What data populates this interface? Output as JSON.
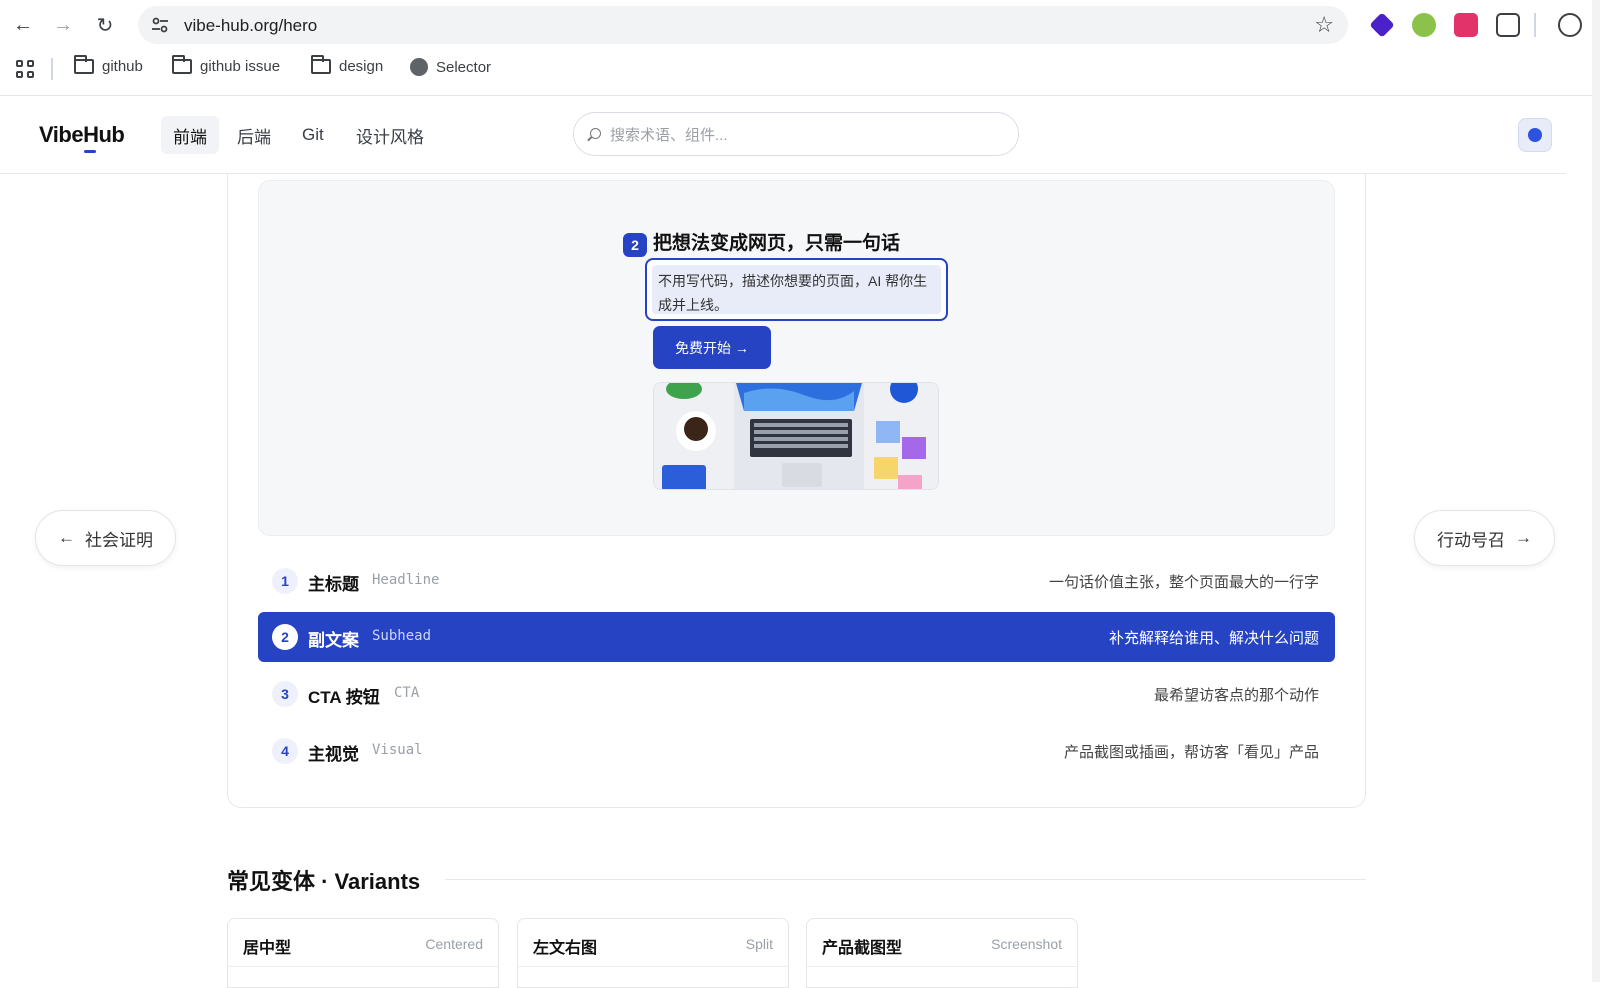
{
  "browser": {
    "url": "vibe-hub.org/hero",
    "bookmarks": [
      {
        "label": "github",
        "icon": "folder-icon"
      },
      {
        "label": "github issue",
        "icon": "folder-icon"
      },
      {
        "label": "design",
        "icon": "folder-icon"
      },
      {
        "label": "Selector",
        "icon": "globe-icon"
      }
    ],
    "extension_colors": [
      "#4b22c9",
      "#5b8a3a",
      "#e2336b",
      "#3c4043"
    ]
  },
  "header": {
    "logo": "VibeHub",
    "nav": [
      "前端",
      "后端",
      "Git",
      "设计风格"
    ],
    "active_nav": "前端",
    "search_placeholder": "搜索术语、组件...",
    "accent_color": "#2643c4"
  },
  "preview": {
    "headline": "把想法变成网页，只需一句话",
    "headline_badge": "2",
    "subhead": "不用写代码，描述你想要的页面，AI 帮你生成并上线。",
    "cta_label": "免费开始 →"
  },
  "pager": {
    "prev_label": "社会证明",
    "next_label": "行动号召"
  },
  "parts": [
    {
      "num": "1",
      "label": "主标题",
      "en": "Headline",
      "desc": "一句话价值主张，整个页面最大的一行字",
      "active": false
    },
    {
      "num": "2",
      "label": "副文案",
      "en": "Subhead",
      "desc": "补充解释给谁用、解决什么问题",
      "active": true
    },
    {
      "num": "3",
      "label": "CTA 按钮",
      "en": "CTA",
      "desc": "最希望访客点的那个动作",
      "active": false
    },
    {
      "num": "4",
      "label": "主视觉",
      "en": "Visual",
      "desc": "产品截图或插画，帮访客「看见」产品",
      "active": false
    }
  ],
  "variants": {
    "title": "常见变体 · Variants",
    "items": [
      {
        "name": "居中型",
        "en": "Centered"
      },
      {
        "name": "左文右图",
        "en": "Split"
      },
      {
        "name": "产品截图型",
        "en": "Screenshot"
      }
    ]
  }
}
